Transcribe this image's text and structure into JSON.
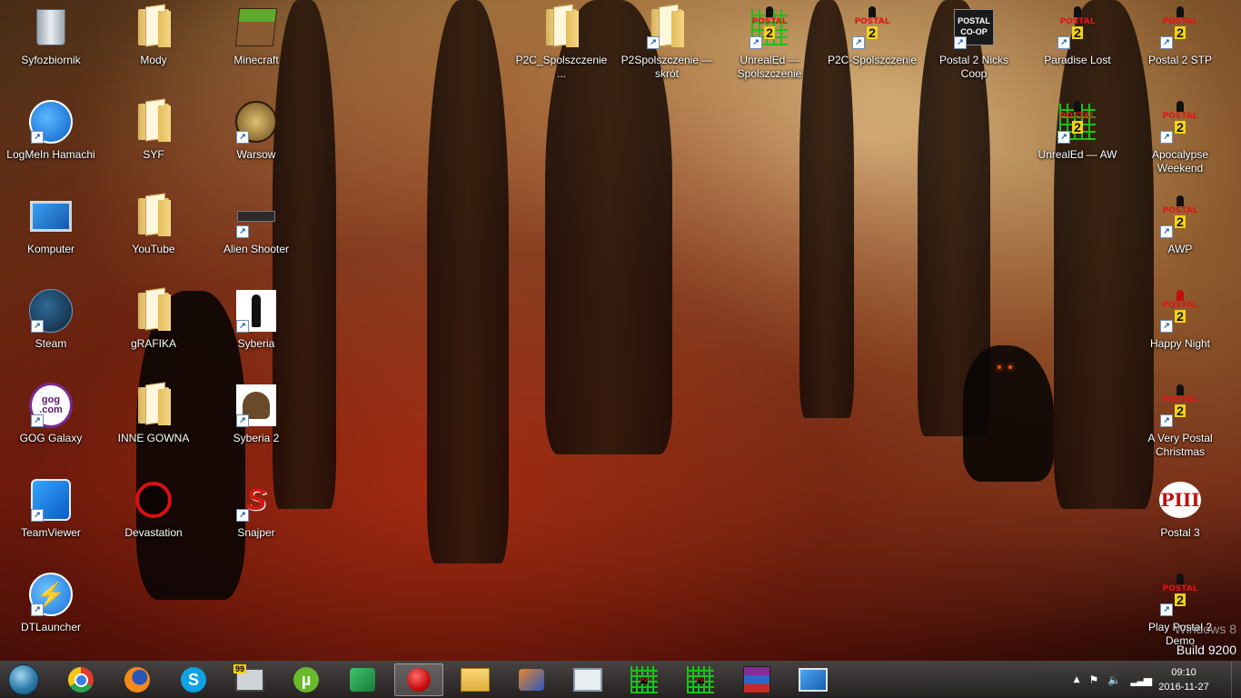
{
  "desktop": {
    "icons_col1": [
      {
        "label": "Syfozbiornik",
        "icon": "recycle-bin-icon"
      },
      {
        "label": "LogMeIn Hamachi",
        "icon": "hamachi-icon"
      },
      {
        "label": "Komputer",
        "icon": "computer-icon"
      },
      {
        "label": "Steam",
        "icon": "steam-icon"
      },
      {
        "label": "GOG Galaxy",
        "icon": "gog-galaxy-icon"
      },
      {
        "label": "TeamViewer",
        "icon": "teamviewer-icon"
      },
      {
        "label": "DTLauncher",
        "icon": "dtlauncher-icon"
      }
    ],
    "icons_col2": [
      {
        "label": "Mody",
        "icon": "folder-icon"
      },
      {
        "label": "SYF",
        "icon": "folder-icon"
      },
      {
        "label": "YouTube",
        "icon": "folder-icon"
      },
      {
        "label": "gRAFIKA",
        "icon": "folder-icon"
      },
      {
        "label": "INNE GOWNA",
        "icon": "folder-icon"
      },
      {
        "label": "Devastation",
        "icon": "devastation-icon"
      }
    ],
    "icons_col3": [
      {
        "label": "Minecraft",
        "icon": "minecraft-icon"
      },
      {
        "label": "Warsow",
        "icon": "warsow-icon"
      },
      {
        "label": "Alien Shooter",
        "icon": "gun-icon"
      },
      {
        "label": "Syberia",
        "icon": "syberia-icon"
      },
      {
        "label": "Syberia 2",
        "icon": "mammoth-icon"
      },
      {
        "label": "Snajper",
        "icon": "snajper-icon"
      }
    ],
    "icons_top": [
      {
        "label": "P2C_Spolszczenie...",
        "icon": "folder-icon"
      },
      {
        "label": "P2Spolszczenie — skrót",
        "icon": "folder-shortcut-icon"
      },
      {
        "label": "UnrealEd — Spolszczenie",
        "icon": "unrealed-icon"
      },
      {
        "label": "P2C-Spolszczenie",
        "icon": "postal2-icon"
      },
      {
        "label": "Postal 2 Nicks Coop",
        "icon": "postal-coop-icon"
      },
      {
        "label": "Paradise Lost",
        "icon": "postal2-icon"
      }
    ],
    "icons_right": [
      {
        "label": "Postal 2 STP",
        "icon": "postal2-icon"
      },
      {
        "label": "Apocalypse Weekend",
        "icon": "postal2-icon"
      },
      {
        "label": "AWP",
        "icon": "postal2-icon"
      },
      {
        "label": "Happy Night",
        "icon": "postal2-icon"
      },
      {
        "label": "A Very Postal Christmas",
        "icon": "postal2-icon"
      },
      {
        "label": "Postal 3",
        "icon": "postal3-icon"
      },
      {
        "label": "Play Postal 2 Demo",
        "icon": "postal2-icon"
      }
    ],
    "icon_extra": {
      "label": "UnrealEd — AW",
      "icon": "unrealed-icon"
    },
    "postal_word": "POSTAL",
    "postal_num": "2",
    "postal3_text": "PIII",
    "coop_text": "POSTAL CO-OP",
    "gog_text": "gog .com",
    "watermark_line1": "Windows 8",
    "watermark_line2": "Build 9200"
  },
  "taskbar": {
    "pinned": [
      {
        "name": "chrome-icon"
      },
      {
        "name": "firefox-icon"
      },
      {
        "name": "skype-icon"
      },
      {
        "name": "monitor-99-icon"
      },
      {
        "name": "utorrent-icon"
      },
      {
        "name": "messenger-icon"
      },
      {
        "name": "record-icon"
      },
      {
        "name": "file-explorer-icon"
      },
      {
        "name": "media-icon"
      },
      {
        "name": "resource-monitor-icon"
      },
      {
        "name": "unrealed-icon"
      },
      {
        "name": "postal2-icon"
      },
      {
        "name": "winrar-icon"
      },
      {
        "name": "remote-desktop-icon"
      }
    ],
    "badge_99": "99",
    "tray_arrow": "▲",
    "clock_time": "09:10",
    "clock_date": "2016-11-27"
  },
  "colors": {
    "postal_red": "#e21515",
    "postal_yellow": "#f2d21a",
    "unreal_green": "#19c219"
  }
}
